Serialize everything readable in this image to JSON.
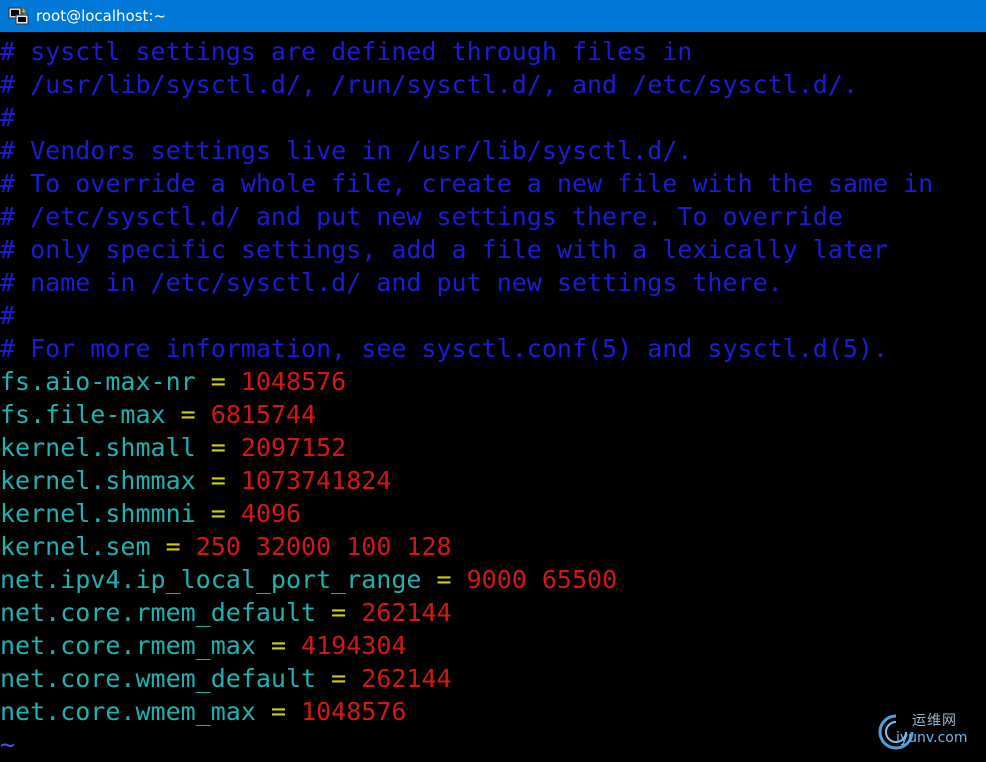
{
  "window": {
    "title": "root@localhost:~",
    "titlebar_color": "#0078d7",
    "icon": "putty-terminal-icon"
  },
  "terminal": {
    "background": "#000000",
    "colors": {
      "comment": "#1c1cd8",
      "key": "#20b2b2",
      "equals": "#d0d000",
      "value": "#d01818",
      "tilde": "#5050ff"
    },
    "comments": [
      "# sysctl settings are defined through files in",
      "# /usr/lib/sysctl.d/, /run/sysctl.d/, and /etc/sysctl.d/.",
      "#",
      "# Vendors settings live in /usr/lib/sysctl.d/.",
      "# To override a whole file, create a new file with the same in",
      "# /etc/sysctl.d/ and put new settings there. To override",
      "# only specific settings, add a file with a lexically later",
      "# name in /etc/sysctl.d/ and put new settings there.",
      "#",
      "# For more information, see sysctl.conf(5) and sysctl.d(5)."
    ],
    "settings": [
      {
        "key": "fs.aio-max-nr",
        "value": "1048576"
      },
      {
        "key": "fs.file-max",
        "value": "6815744"
      },
      {
        "key": "kernel.shmall",
        "value": "2097152"
      },
      {
        "key": "kernel.shmmax",
        "value": "1073741824"
      },
      {
        "key": "kernel.shmmni",
        "value": "4096"
      },
      {
        "key": "kernel.sem",
        "value": "250 32000 100 128"
      },
      {
        "key": "net.ipv4.ip_local_port_range",
        "value": "9000 65500"
      },
      {
        "key": "net.core.rmem_default",
        "value": "262144"
      },
      {
        "key": "net.core.rmem_max",
        "value": "4194304"
      },
      {
        "key": "net.core.wmem_default",
        "value": "262144"
      },
      {
        "key": "net.core.wmem_max",
        "value": "1048576"
      }
    ],
    "equals_sign": "=",
    "empty_line_marker": "~"
  },
  "watermark": {
    "text_cn": "运维网",
    "url": "iyunv.com"
  }
}
